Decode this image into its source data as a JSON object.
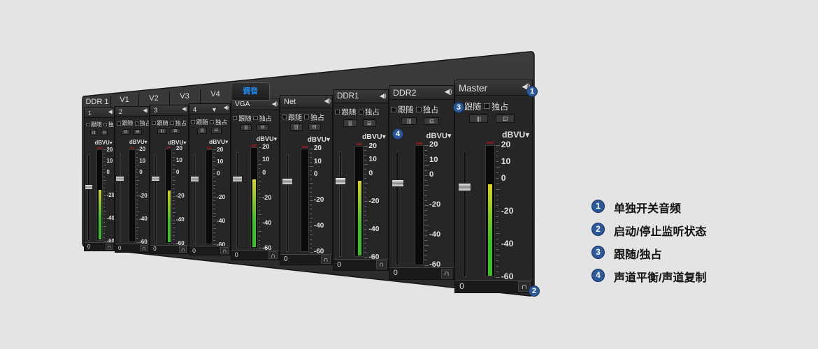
{
  "mixer": {
    "tabs": [
      "DDR 1",
      "V1",
      "V2",
      "V3",
      "V4",
      "调音"
    ],
    "active_tab": "调音",
    "follow_label": "跟随",
    "solo_label": "独占",
    "unit_label": "dBVU",
    "scale": [
      "20",
      "10",
      "0",
      "-20",
      "-40",
      "-60"
    ],
    "strips": [
      {
        "name": "1",
        "value": "0",
        "fader": 0.62,
        "meter": 0.55
      },
      {
        "name": "2",
        "value": "0",
        "fader": 0.72,
        "meter": 0.0
      },
      {
        "name": "3",
        "value": "0",
        "fader": 0.72,
        "meter": 0.55
      },
      {
        "name": "4",
        "value": "0",
        "fader": 0.72,
        "meter": 0.0
      },
      {
        "name": "VGA",
        "value": "0",
        "fader": 0.72,
        "meter": 0.68
      },
      {
        "name": "Net",
        "value": "0",
        "fader": 0.72,
        "meter": 0.0
      },
      {
        "name": "DDR1",
        "value": "0",
        "fader": 0.72,
        "meter": 0.68
      },
      {
        "name": "DDR2",
        "value": "0",
        "fader": 0.72,
        "meter": 0.0
      },
      {
        "name": "Master",
        "value": "0",
        "fader": 0.72,
        "meter": 0.7
      }
    ]
  },
  "markers": [
    "1",
    "2",
    "3",
    "4"
  ],
  "legend": [
    {
      "num": "1",
      "text": "单独开关音频"
    },
    {
      "num": "2",
      "text": "启动/停止监听状态"
    },
    {
      "num": "3",
      "text": "跟随/独占"
    },
    {
      "num": "4",
      "text": "声道平衡/声道复制"
    }
  ],
  "colors": {
    "background": "#e4e4e4",
    "panel": "#262626",
    "active_tab": "#1e90ff",
    "marker": "#2b5a9a",
    "meter_green": "#3fbf2a",
    "meter_yellow": "#d9d21f"
  }
}
